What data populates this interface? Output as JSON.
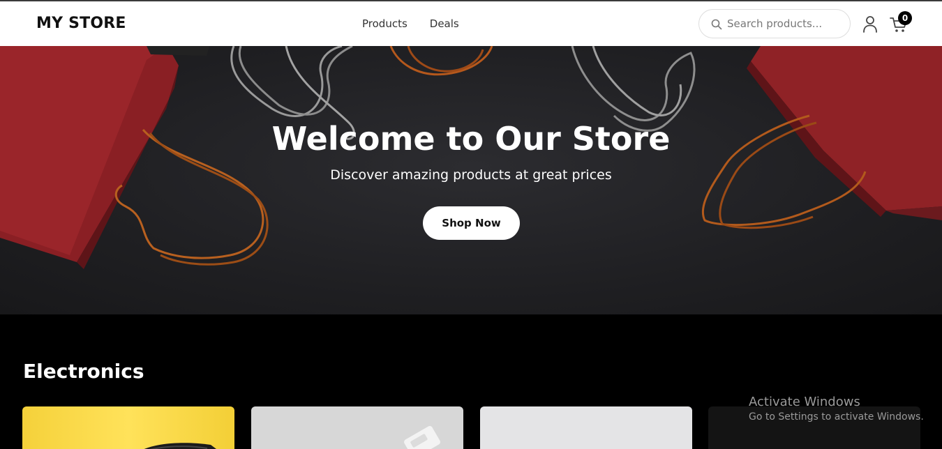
{
  "header": {
    "logo": "MY STORE",
    "nav": [
      "Products",
      "Deals"
    ],
    "search_placeholder": "Search products...",
    "cart_count": "0",
    "icons": [
      "search-icon",
      "user-icon",
      "cart-icon"
    ]
  },
  "hero": {
    "title": "Welcome to Our Store",
    "subtitle": "Discover amazing products at great prices",
    "cta_label": "Shop Now"
  },
  "section": {
    "title": "Electronics"
  },
  "os_overlay": {
    "line1": "Activate Windows",
    "line2": "Go to Settings to activate Windows."
  },
  "colors": {
    "header_bg": "#ffffff",
    "page_bg": "#000000",
    "hero_bag_red": "#8f2226",
    "cta_bg": "#ffffff"
  }
}
